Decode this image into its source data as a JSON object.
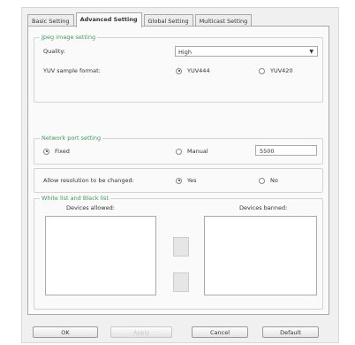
{
  "tabs": [
    {
      "label": "Basic Setting",
      "active": false
    },
    {
      "label": "Advanced Setting",
      "active": true
    },
    {
      "label": "Global Setting",
      "active": false
    },
    {
      "label": "Multicast Setting",
      "active": false
    }
  ],
  "jpeg_group": {
    "title": "Jpeg image setting",
    "quality_label": "Quality:",
    "quality_value": "High",
    "yuv_label": "YUV sample format:",
    "yuv_options": [
      {
        "label": "YUV444",
        "selected": true
      },
      {
        "label": "YUV420",
        "selected": false
      }
    ]
  },
  "network_group": {
    "title": "Network port setting",
    "fixed_label": "Fixed",
    "fixed_selected": true,
    "manual_label": "Manual",
    "manual_selected": false,
    "port_value": "5500"
  },
  "resolution": {
    "label": "Allow resolution to be changed:",
    "yes_label": "Yes",
    "yes_selected": true,
    "no_label": "No",
    "no_selected": false
  },
  "lists_group": {
    "title": "White list and Black list",
    "allowed_label": "Devices allowed:",
    "banned_label": "Devices banned:"
  },
  "buttons": {
    "ok": "OK",
    "apply": "Apply",
    "cancel": "Cancel",
    "default": "Default"
  },
  "colors": {
    "group_title": "#3e9a5e",
    "dialog_bg": "#f0f0f0"
  },
  "icons": {
    "dropdown": "chevron-down-icon"
  }
}
